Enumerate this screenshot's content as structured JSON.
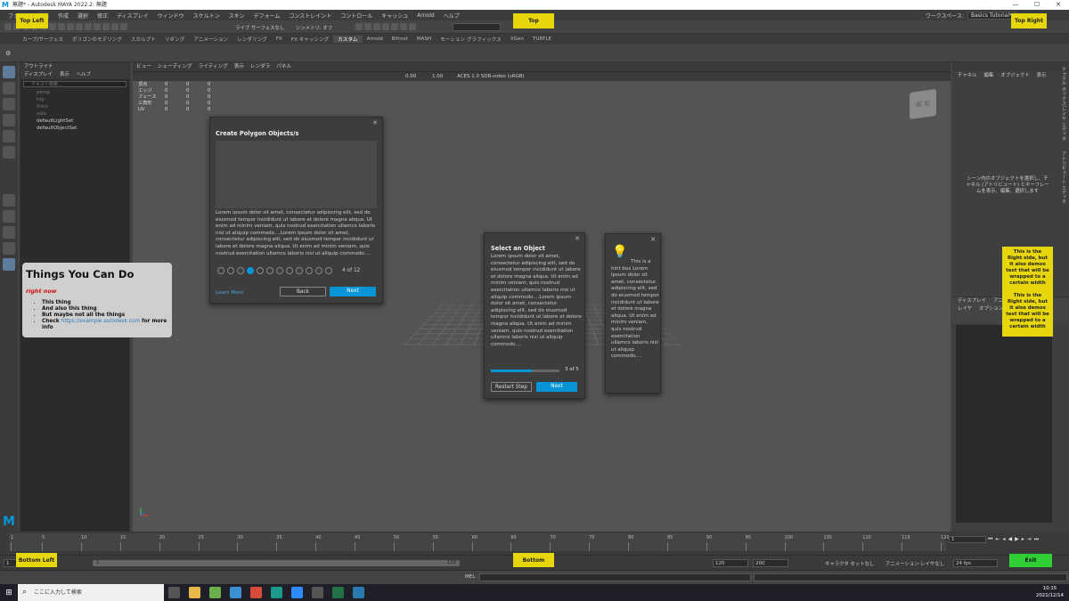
{
  "title_bar": {
    "text": "無題* - Autodesk MAYA 2022.2: 無題"
  },
  "menu": [
    "ファイル",
    "編集",
    "作成",
    "選択",
    "修正",
    "ディスプレイ",
    "ウィンドウ",
    "スケルトン",
    "スキン",
    "デフォーム",
    "コンストレイント",
    "コントロール",
    "キャッシュ",
    "Arnold",
    "ヘルプ"
  ],
  "workspace": {
    "label": "ワークスペース:",
    "value": "Basics Tutorial*"
  },
  "statusline": {
    "live_surface": "ライブ サーフェスなし",
    "symmetry": "シンメトリ: オフ"
  },
  "shelf_tabs": [
    "カーブ/サーフェス",
    "ポリゴンのモデリング",
    "スカルプト",
    "リギング",
    "アニメーション",
    "レンダリング",
    "FX",
    "FX キャッシング",
    "カスタム",
    "Arnold",
    "Bifrost",
    "MASH",
    "モーション グラフィックス",
    "XGen",
    "TURTLE"
  ],
  "shelf_tab_active": "カスタム",
  "outliner": {
    "title": "アウトライナ",
    "menu": [
      "ディスプレイ",
      "表示",
      "ヘルプ"
    ],
    "search_placeholder": "テキスト検索...",
    "items": [
      "persp",
      "top",
      "front",
      "side",
      "defaultLightSet",
      "defaultObjectSet"
    ]
  },
  "viewport": {
    "menu": [
      "ビュー",
      "シェーディング",
      "ライティング",
      "表示",
      "レンダラ",
      "パネル"
    ],
    "field1": "0.00",
    "field2": "1.00",
    "colorspace": "ACES 1.0 SDR-video (sRGB)",
    "hud": [
      {
        "label": "頂点",
        "a": "0",
        "b": "0",
        "c": "0"
      },
      {
        "label": "エッジ",
        "a": "0",
        "b": "0",
        "c": "0"
      },
      {
        "label": "フェース",
        "a": "0",
        "b": "0",
        "c": "0"
      },
      {
        "label": "三角形",
        "a": "0",
        "b": "0",
        "c": "0"
      },
      {
        "label": "UV",
        "a": "0",
        "b": "0",
        "c": "0"
      }
    ],
    "viewcube": {
      "left": "前",
      "right": "右"
    }
  },
  "channel_box": {
    "menu": [
      "チャネル",
      "編集",
      "オブジェクト",
      "表示"
    ],
    "message": "シーン内のオブジェクトを選択し、チャネル (アトリビュート) とキーフレームを表示、編集、選択します",
    "layer_menu": [
      "ディスプレイ",
      "アニ"
    ],
    "layer_menu2": [
      "レイヤ",
      "オプション"
    ],
    "side_tabs": [
      "チャネル ボックス/レイヤ エディタ",
      "アトリビュート エディタ"
    ]
  },
  "dialog_polygon": {
    "title": "Create Polygon Objects/s",
    "body": "Lorem ipsum dolor sit amet, consectetur adipiscing elit, sed do eiusmod tempor incididunt ut labore et dolore magna aliqua. Ut enim ad minim veniam, quis nostrud exercitation ullamco laboris nisi ut aliquip commodo....Lorem ipsum dolor sit amet, consectetur adipiscing elit, sed do eiusmod tempor incididunt ut labore et dolore magna aliqua. Ut enim ad minim veniam, quis nostrud exercitation ullamco laboris nisi ut aliquip commodo....",
    "step": "4 of 12",
    "total_dots": 12,
    "active_dot": 4,
    "learn_more": "Learn More",
    "back": "Back",
    "next": "Next"
  },
  "dialog_select": {
    "title": "Select an Object",
    "body": "Lorem ipsum dolor sit amet, consectetur adipiscing elit, sed do eiusmod tempor incididunt ut labore et dolore magna aliqua. Ut enim ad minim veniam, quis nostrud exercitation ullamco laboris nisi ut aliquip commodo....Lorem ipsum dolor sit amet, consectetur adipiscing elit, sed do eiusmod tempor incididunt ut labore et dolore magna aliqua. Ut enim ad minim veniam, quis nostrud exercitation ullamco laboris nisi ut aliquip commodo....",
    "progress": 0.6,
    "step": "3 of 5",
    "restart": "Restart Step",
    "next": "Next"
  },
  "hint_box": {
    "text": "This is a hint box Lorem ipsum dolor sit amet, consectetur adipiscing elit, sed do eiusmod tempor incididunt ut labore et dolore magna aliqua. Ut enim ad minim veniam, quis nostrud exercitation ullamco laboris nisi ut aliquip commodo...."
  },
  "things_you_can_do": {
    "title": "Things You Can Do",
    "subtitle": "right now",
    "items": [
      "This thing",
      "And also this thing",
      "But maybe not all the things"
    ],
    "check_prefix": "Check",
    "link": "https://example.autodesk.com",
    "check_suffix": "for more info"
  },
  "labels": {
    "top_left": "Top Left",
    "top": "Top",
    "top_right": "Top Right",
    "bottom_left": "Bottom Left",
    "bottom": "Bottom",
    "exit": "Exit",
    "right_side": "This is the Right side, but it also demos text that will be wrapped to a certain width\n\nThis is the Right side, but it also demos text that will be wrapped to a certain width"
  },
  "timeline": {
    "ticks": [
      "1",
      "5",
      "10",
      "15",
      "20",
      "25",
      "30",
      "35",
      "40",
      "45",
      "50",
      "55",
      "60",
      "65",
      "70",
      "75",
      "80",
      "85",
      "90",
      "95",
      "100",
      "105",
      "110",
      "115",
      "120"
    ],
    "current": "1"
  },
  "range": {
    "start": "1",
    "inner_start": "1",
    "inner_end": "120",
    "end1": "120",
    "end2": "200",
    "character": "キャラクタ セットなし",
    "anim_layer": "アニメーション レイヤなし",
    "fps": "24 fps"
  },
  "cmdline": {
    "label": "MEL"
  },
  "taskbar": {
    "search": "ここに入力して検索",
    "time": "10:15",
    "date": "2021/12/14"
  },
  "colors": {
    "accent": "#0696d7",
    "yellow": "#e8d60c"
  }
}
